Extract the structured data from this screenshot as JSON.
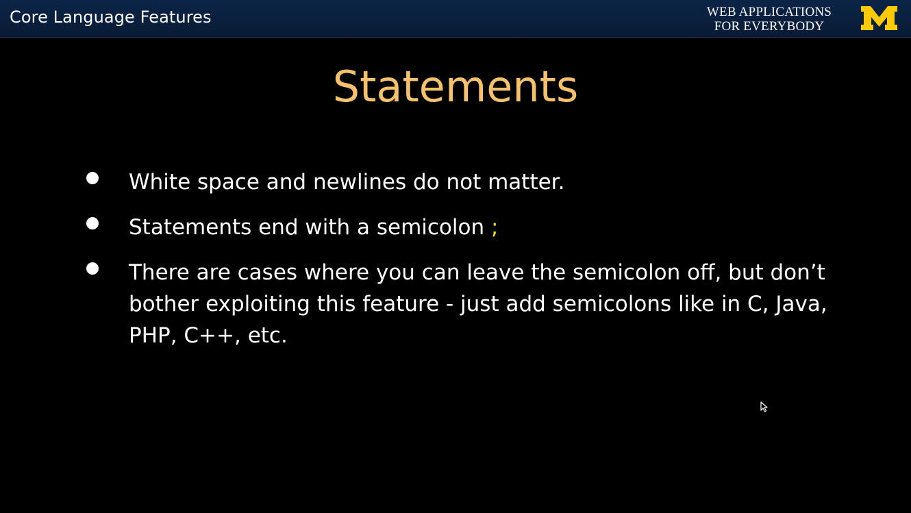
{
  "header": {
    "section_title": "Core Language Features",
    "course_line_1": "WEB APPLICATIONS",
    "course_line_2": "FOR EVERYBODY",
    "logo_letter": "M",
    "logo_color": "#ffcb05"
  },
  "slide": {
    "title": "Statements",
    "title_color": "#f5c26b",
    "bullets": [
      {
        "text": "White space and newlines do not matter."
      },
      {
        "text": "Statements end with a semicolon ",
        "accent": ";"
      },
      {
        "text": "There are cases where you can leave the semicolon off, but don’t bother exploiting this feature - just add semicolons like in C, Java, PHP, C++, etc."
      }
    ],
    "accent_color": "#f7e600"
  },
  "icons": {
    "logo": "university-block-m-logo",
    "cursor": "mouse-pointer-icon",
    "bullet": "bullet-dot-icon"
  }
}
